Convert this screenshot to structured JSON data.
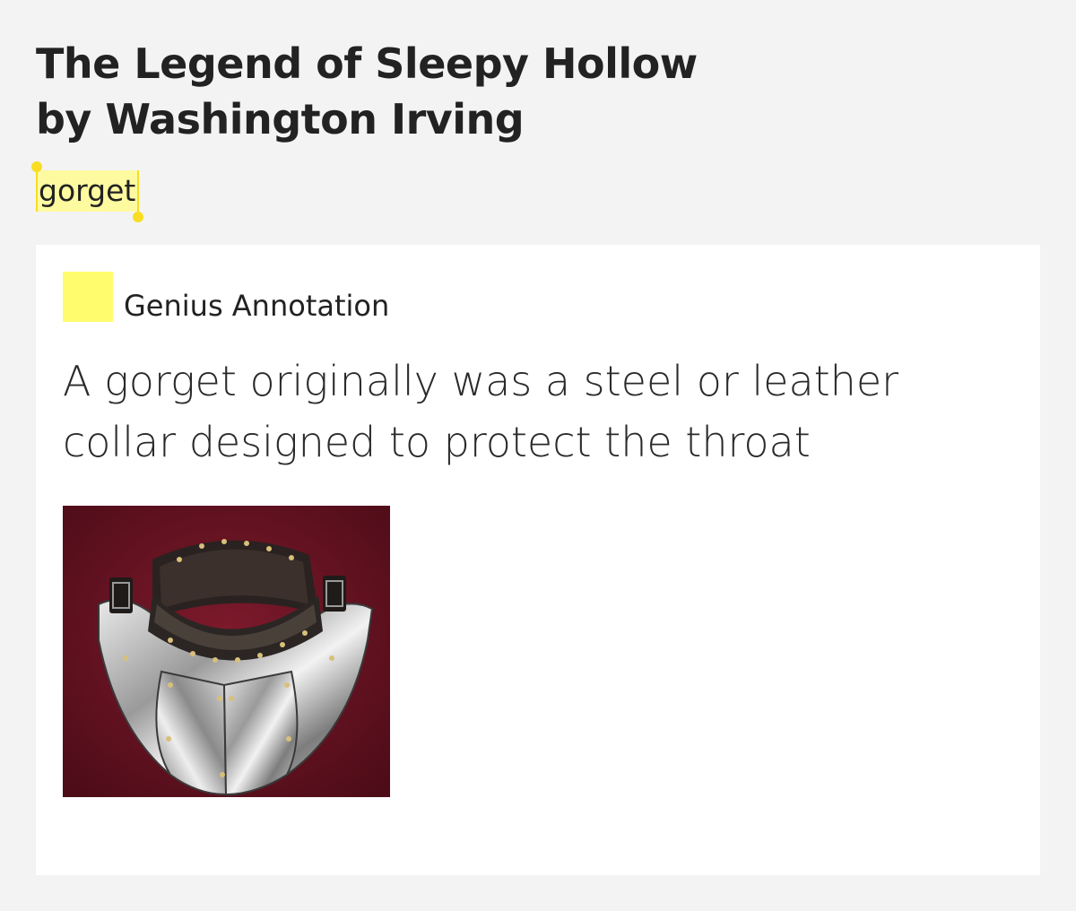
{
  "song": {
    "title": "The Legend of Sleepy Hollow",
    "byline": "by Washington Irving"
  },
  "highlight": {
    "text": "gorget",
    "color": "#fefaa0",
    "handle_color": "#f8dd23"
  },
  "annotation": {
    "source_label": "Genius Annotation",
    "badge_color": "#fffd6d",
    "body": "A gorget originally was a steel or leather collar designed to protect the throat",
    "image": {
      "icon": "gorget-armor-photo",
      "background_color": "#6b1423"
    }
  }
}
